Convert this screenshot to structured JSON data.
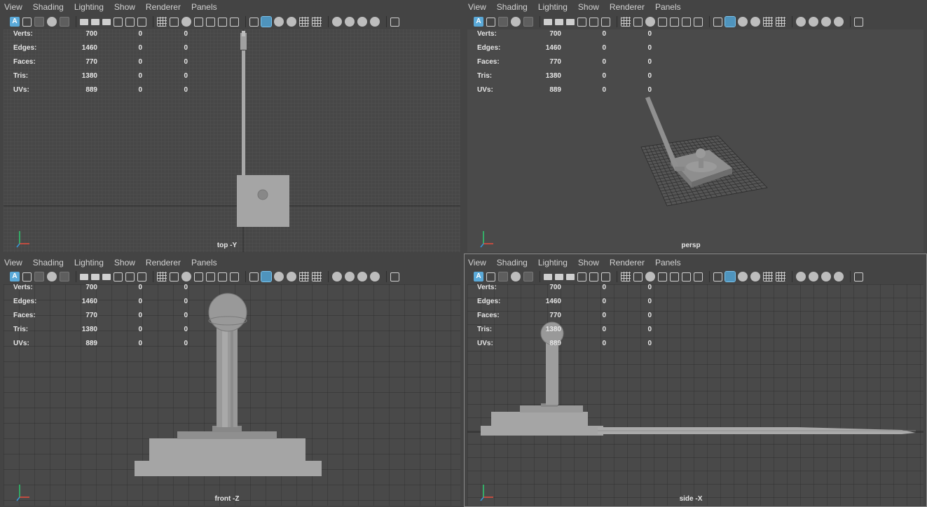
{
  "menus": [
    "View",
    "Shading",
    "Lighting",
    "Show",
    "Renderer",
    "Panels"
  ],
  "toolbar_icons": [
    "select-camera-icon",
    "camera-attributes-icon",
    "bookmarks-icon",
    "image-plane-icon",
    "2d-pan-zoom-icon",
    "grease-pencil-icon",
    "grid-icon",
    "film-gate-icon",
    "resolution-gate-icon",
    "gate-mask-icon",
    "field-chart-icon",
    "safe-action-icon",
    "safe-title-icon",
    "wireframe-icon",
    "smooth-shade-icon",
    "use-default-material-icon",
    "wireframe-on-shaded-icon",
    "xray-icon",
    "xray-joints-icon",
    "xray-components-icon",
    "use-all-lights-icon",
    "shadows-icon",
    "screen-space-ambient-occlusion-icon",
    "motion-blur-icon",
    "multisample-antialiasing-icon",
    "depth-of-field-icon",
    "isolate-select-icon"
  ],
  "accent_color": "#5aa9d8",
  "stats": [
    {
      "label": "Verts:",
      "v1": "700",
      "v2": "0",
      "v3": "0"
    },
    {
      "label": "Edges:",
      "v1": "1460",
      "v2": "0",
      "v3": "0"
    },
    {
      "label": "Faces:",
      "v1": "770",
      "v2": "0",
      "v3": "0"
    },
    {
      "label": "Tris:",
      "v1": "1380",
      "v2": "0",
      "v3": "0"
    },
    {
      "label": "UVs:",
      "v1": "889",
      "v2": "0",
      "v3": "0"
    }
  ],
  "viewports": [
    {
      "id": "top",
      "label": "top -Y",
      "axes": [
        "y",
        "x",
        "z"
      ]
    },
    {
      "id": "persp",
      "label": "persp",
      "axes": [
        "y",
        "z",
        "x"
      ]
    },
    {
      "id": "front",
      "label": "front -Z",
      "axes": [
        "y",
        "x"
      ]
    },
    {
      "id": "side",
      "label": "side -X",
      "axes": [
        "y",
        "z"
      ]
    }
  ]
}
